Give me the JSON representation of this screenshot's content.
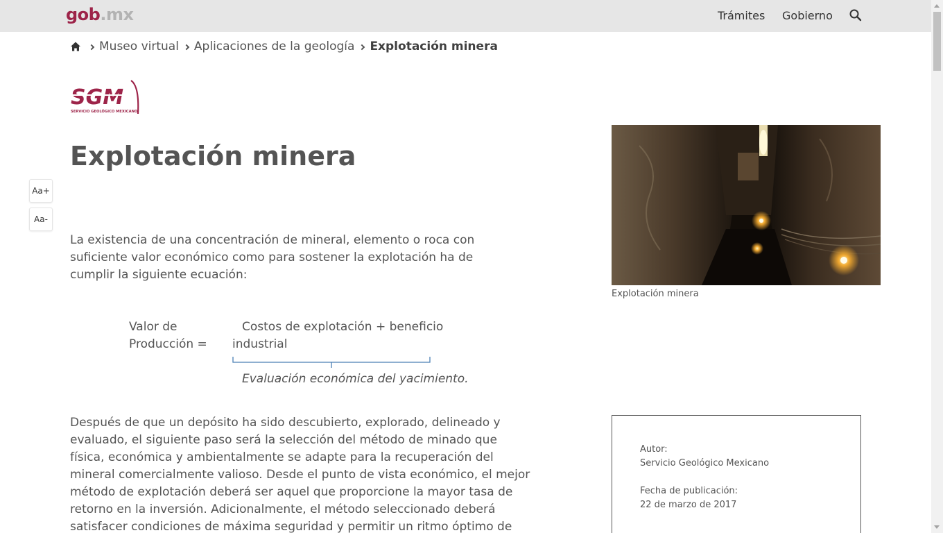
{
  "header": {
    "brand_part1": "gob",
    "brand_part2": ".mx",
    "nav": [
      "Trámites",
      "Gobierno"
    ],
    "brand_color": "#9d2449"
  },
  "breadcrumb": {
    "items": [
      "Museo virtual",
      "Aplicaciones de la geología"
    ],
    "current": "Explotación minera"
  },
  "logo": {
    "letters": "SGM",
    "subtitle": "SERVICIO GEOLÓGICO MEXICANO"
  },
  "page": {
    "title": "Explotación minera",
    "font_increase": "Aa+",
    "font_decrease": "Aa-",
    "intro": "La existencia de una concentración de mineral, elemento o roca con suficiente valor económico como para sostener la explotación ha de cumplir la siguiente ecuación:",
    "equation": {
      "left_line1": "Valor de",
      "left_line2": "Producción =",
      "right_line1": "Costos de explotación + beneficio",
      "right_line2": "industrial",
      "caption": "Evaluación económica del yacimiento."
    },
    "body": "Después de que un depósito ha sido descubierto, explorado, delineado y evaluado, el siguiente paso será la selección del método de minado que física, económica y ambientalmente se adapte para la recuperación del mineral comercialmente valioso. Desde el punto de vista económico, el mejor método de explotación deberá ser aquel que proporcione  la mayor tasa de retorno en la inversión. Adicionalmente, el método seleccionado deberá satisfacer condiciones de máxima seguridad y permitir un ritmo óptimo de extracción bajo"
  },
  "sidebar": {
    "image_caption": "Explotación minera",
    "author_label": "Autor:",
    "author": "Servicio Geológico Mexicano",
    "date_label": "Fecha de publicación:",
    "date": "22 de marzo de 2017"
  }
}
